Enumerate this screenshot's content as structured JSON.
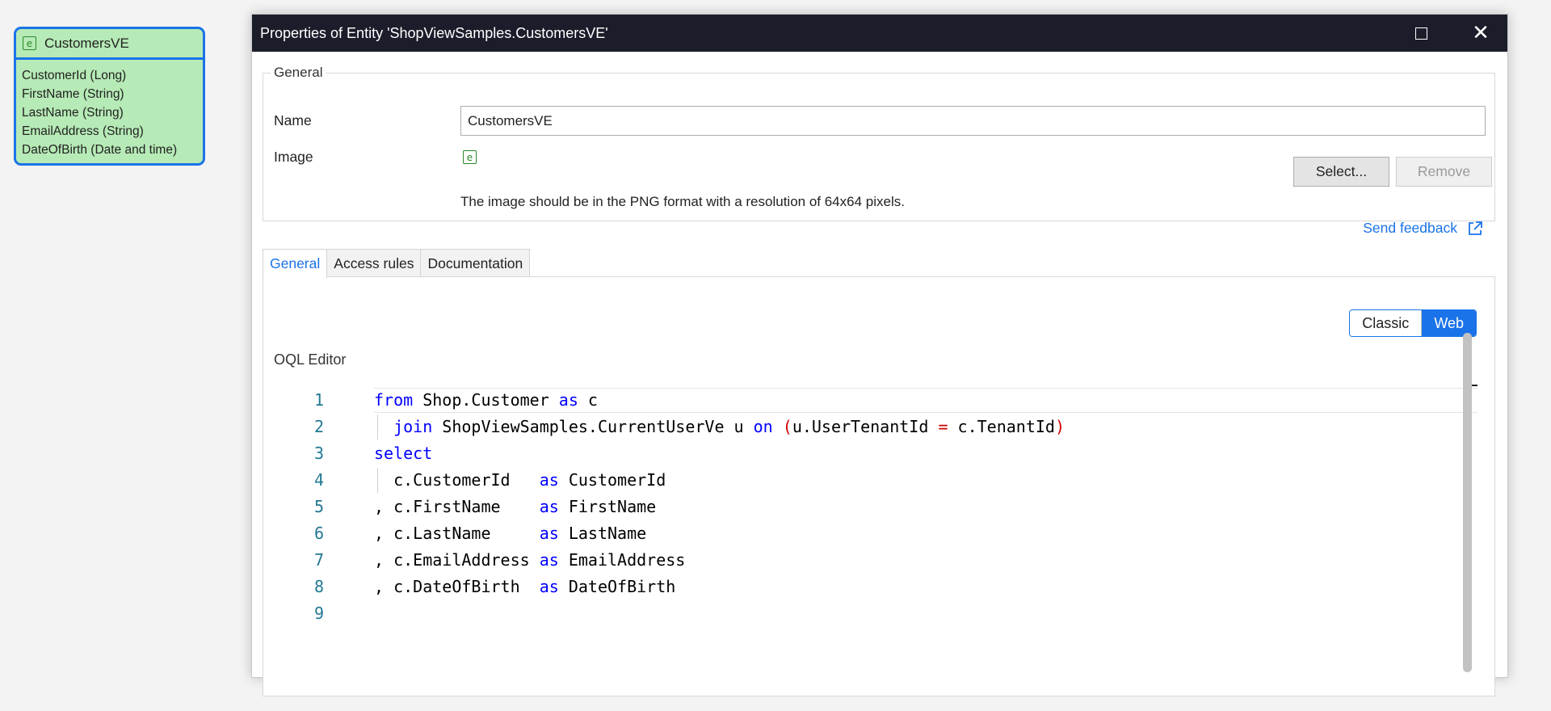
{
  "canvas": {
    "entity": {
      "name": "CustomersVE",
      "icon": "entity-icon",
      "attributes": [
        "CustomerId (Long)",
        "FirstName (String)",
        "LastName (String)",
        "EmailAddress (String)",
        "DateOfBirth (Date and time)"
      ]
    }
  },
  "dialog": {
    "title": "Properties of Entity 'ShopViewSamples.CustomersVE'",
    "general": {
      "legend": "General",
      "name_label": "Name",
      "name_value": "CustomersVE",
      "image_label": "Image",
      "select_label": "Select...",
      "remove_label": "Remove",
      "image_hint": "The image should be in the PNG format with a resolution of 64x64 pixels.",
      "feedback_label": "Send feedback"
    },
    "tabs": [
      {
        "label": "General",
        "active": true
      },
      {
        "label": "Access rules",
        "active": false
      },
      {
        "label": "Documentation",
        "active": false
      }
    ],
    "mode_toggle": {
      "classic": "Classic",
      "web": "Web",
      "selected": "Web"
    },
    "oql_label": "OQL Editor",
    "line_numbers": [
      "1",
      "2",
      "3",
      "4",
      "5",
      "6",
      "7",
      "8",
      "9"
    ]
  },
  "colors": {
    "accent": "#1a73e8",
    "titlebar": "#1c1d2b",
    "entity_fill": "#b6eab6",
    "keyword": "#0000ff",
    "operator": "#d00000",
    "line_number": "#237893"
  }
}
